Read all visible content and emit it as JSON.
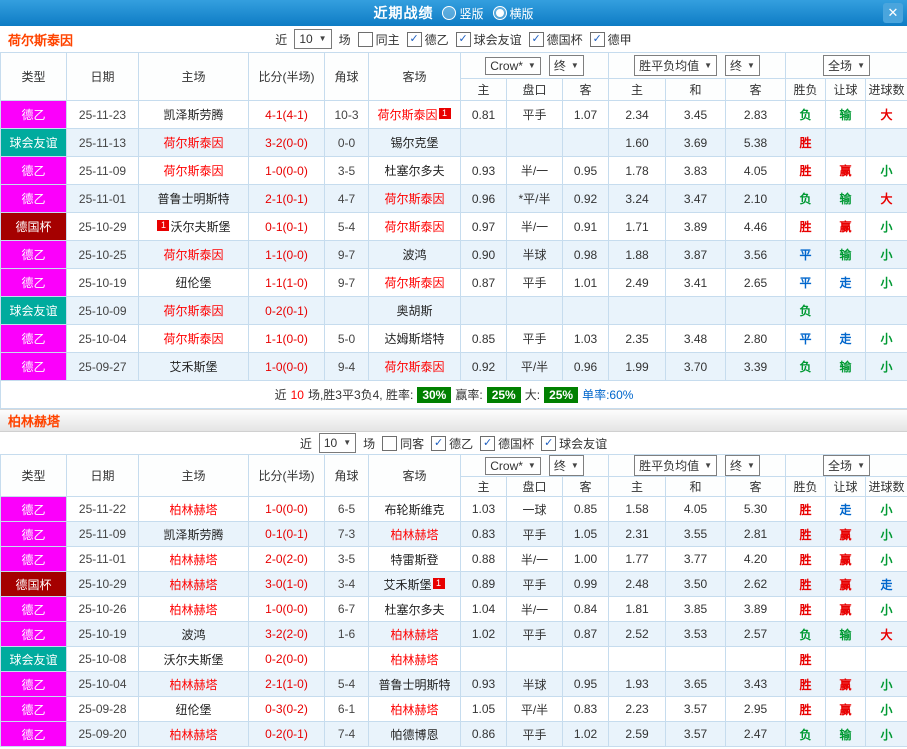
{
  "icons": {
    "dropdown_arrow": "▼",
    "check": "✓"
  },
  "colors": {
    "topbar": "#1583cb",
    "league_de2": "#fb00fb",
    "league_friendly": "#00ab9e",
    "league_cup": "#a50000",
    "win_red": "#e80000",
    "draw_blue": "#0066cc",
    "loss_green": "#009933",
    "rate_badge_green": "#008000",
    "team_highlight": "#ff0000",
    "section_title": "#ff4400",
    "row_alt": "#e9f3fb",
    "grid_border": "#c6dcee"
  },
  "topbar": {
    "title": "近期战绩",
    "radios": [
      {
        "label": "竖版",
        "checked": false
      },
      {
        "label": "横版",
        "checked": true
      }
    ],
    "close": "✕"
  },
  "sections": [
    {
      "team": "荷尔斯泰因",
      "combined_header": true,
      "filter": {
        "near": "近",
        "count": "10",
        "unit": "场",
        "checkboxes": [
          {
            "label": "同主",
            "checked": false
          },
          {
            "label": "德乙",
            "checked": true
          },
          {
            "label": "球会友谊",
            "checked": true
          },
          {
            "label": "德国杯",
            "checked": true
          },
          {
            "label": "德甲",
            "checked": true
          }
        ]
      },
      "header": {
        "cols": [
          "类型",
          "日期",
          "主场",
          "比分(半场)",
          "角球",
          "客场"
        ],
        "dropdowns": [
          "Crow*",
          "终",
          "胜平负均值",
          "终",
          "全场"
        ],
        "sub": [
          "主",
          "盘口",
          "客",
          "主",
          "和",
          "客",
          "胜负",
          "让球",
          "进球数"
        ]
      },
      "rows": [
        {
          "lg": "de2",
          "league": "德乙",
          "date": "25-11-23",
          "home": {
            "name": "凯泽斯劳腾",
            "red": false
          },
          "score": "4-1(4-1)",
          "corners": "10-3",
          "away": {
            "name": "荷尔斯泰因",
            "red": true,
            "badge": "1",
            "pos": "after"
          },
          "crow": [
            "0.81",
            "平手",
            "1.07"
          ],
          "avg": [
            "2.34",
            "3.45",
            "2.83"
          ],
          "res": [
            [
              "负",
              "g"
            ],
            [
              "输",
              "g"
            ],
            [
              "大",
              "r"
            ]
          ]
        },
        {
          "lg": "friendly",
          "league": "球会友谊",
          "date": "25-11-13",
          "home": {
            "name": "荷尔斯泰因",
            "red": true
          },
          "score": "3-2(0-0)",
          "corners": "0-0",
          "away": {
            "name": "锡尔克堡",
            "red": false
          },
          "crow": [
            "",
            "",
            ""
          ],
          "avg": [
            "1.60",
            "3.69",
            "5.38"
          ],
          "res": [
            [
              "胜",
              "r"
            ],
            [
              "",
              ""
            ],
            [
              "",
              ""
            ]
          ]
        },
        {
          "lg": "de2",
          "league": "德乙",
          "date": "25-11-09",
          "home": {
            "name": "荷尔斯泰因",
            "red": true
          },
          "score": "1-0(0-0)",
          "corners": "3-5",
          "away": {
            "name": "杜塞尔多夫",
            "red": false
          },
          "crow": [
            "0.93",
            "半/一",
            "0.95"
          ],
          "avg": [
            "1.78",
            "3.83",
            "4.05"
          ],
          "res": [
            [
              "胜",
              "r"
            ],
            [
              "赢",
              "r"
            ],
            [
              "小",
              "g"
            ]
          ]
        },
        {
          "lg": "de2",
          "league": "德乙",
          "date": "25-11-01",
          "home": {
            "name": "普鲁士明斯特",
            "red": false
          },
          "score": "2-1(0-1)",
          "corners": "4-7",
          "away": {
            "name": "荷尔斯泰因",
            "red": true
          },
          "crow": [
            "0.96",
            "*平/半",
            "0.92"
          ],
          "avg": [
            "3.24",
            "3.47",
            "2.10"
          ],
          "res": [
            [
              "负",
              "g"
            ],
            [
              "输",
              "g"
            ],
            [
              "大",
              "r"
            ]
          ]
        },
        {
          "lg": "cup",
          "league": "德国杯",
          "date": "25-10-29",
          "home": {
            "name": "沃尔夫斯堡",
            "red": false,
            "badge": "1",
            "pos": "before"
          },
          "score": "0-1(0-1)",
          "corners": "5-4",
          "away": {
            "name": "荷尔斯泰因",
            "red": true
          },
          "crow": [
            "0.97",
            "半/一",
            "0.91"
          ],
          "avg": [
            "1.71",
            "3.89",
            "4.46"
          ],
          "res": [
            [
              "胜",
              "r"
            ],
            [
              "赢",
              "r"
            ],
            [
              "小",
              "g"
            ]
          ]
        },
        {
          "lg": "de2",
          "league": "德乙",
          "date": "25-10-25",
          "home": {
            "name": "荷尔斯泰因",
            "red": true
          },
          "score": "1-1(0-0)",
          "corners": "9-7",
          "away": {
            "name": "波鸿",
            "red": false
          },
          "crow": [
            "0.90",
            "半球",
            "0.98"
          ],
          "avg": [
            "1.88",
            "3.87",
            "3.56"
          ],
          "res": [
            [
              "平",
              "b"
            ],
            [
              "输",
              "g"
            ],
            [
              "小",
              "g"
            ]
          ]
        },
        {
          "lg": "de2",
          "league": "德乙",
          "date": "25-10-19",
          "home": {
            "name": "纽伦堡",
            "red": false
          },
          "score": "1-1(1-0)",
          "corners": "9-7",
          "away": {
            "name": "荷尔斯泰因",
            "red": true
          },
          "crow": [
            "0.87",
            "平手",
            "1.01"
          ],
          "avg": [
            "2.49",
            "3.41",
            "2.65"
          ],
          "res": [
            [
              "平",
              "b"
            ],
            [
              "走",
              "b"
            ],
            [
              "小",
              "g"
            ]
          ]
        },
        {
          "lg": "friendly",
          "league": "球会友谊",
          "date": "25-10-09",
          "home": {
            "name": "荷尔斯泰因",
            "red": true
          },
          "score": "0-2(0-1)",
          "corners": "",
          "away": {
            "name": "奥胡斯",
            "red": false
          },
          "crow": [
            "",
            "",
            ""
          ],
          "avg": [
            "",
            "",
            ""
          ],
          "res": [
            [
              "负",
              "g"
            ],
            [
              "",
              ""
            ],
            [
              "",
              ""
            ]
          ]
        },
        {
          "lg": "de2",
          "league": "德乙",
          "date": "25-10-04",
          "home": {
            "name": "荷尔斯泰因",
            "red": true
          },
          "score": "1-1(0-0)",
          "corners": "5-0",
          "away": {
            "name": "达姆斯塔特",
            "red": false
          },
          "crow": [
            "0.85",
            "平手",
            "1.03"
          ],
          "avg": [
            "2.35",
            "3.48",
            "2.80"
          ],
          "res": [
            [
              "平",
              "b"
            ],
            [
              "走",
              "b"
            ],
            [
              "小",
              "g"
            ]
          ]
        },
        {
          "lg": "de2",
          "league": "德乙",
          "date": "25-09-27",
          "home": {
            "name": "艾禾斯堡",
            "red": false
          },
          "score": "1-0(0-0)",
          "corners": "9-4",
          "away": {
            "name": "荷尔斯泰因",
            "red": true
          },
          "crow": [
            "0.92",
            "平/半",
            "0.96"
          ],
          "avg": [
            "1.99",
            "3.70",
            "3.39"
          ],
          "res": [
            [
              "负",
              "g"
            ],
            [
              "输",
              "g"
            ],
            [
              "小",
              "g"
            ]
          ]
        }
      ],
      "summary": {
        "prefix": "近",
        "count": "10",
        "mid": "场,胜3平3负4, 胜率:",
        "win_rate": "30%",
        "label2": "赢率:",
        "rate2": "25%",
        "label3": "大:",
        "rate3": "25%",
        "tail": "单率:60%"
      }
    },
    {
      "team": "柏林赫塔",
      "combined_header": false,
      "filter": {
        "near": "近",
        "count": "10",
        "unit": "场",
        "checkboxes": [
          {
            "label": "同客",
            "checked": false
          },
          {
            "label": "德乙",
            "checked": true
          },
          {
            "label": "德国杯",
            "checked": true
          },
          {
            "label": "球会友谊",
            "checked": true
          }
        ]
      },
      "header": {
        "cols": [
          "类型",
          "日期",
          "主场",
          "比分(半场)",
          "角球",
          "客场"
        ],
        "dropdowns": [
          "Crow*",
          "终",
          "胜平负均值",
          "终",
          "全场"
        ],
        "sub": [
          "主",
          "盘口",
          "客",
          "主",
          "和",
          "客",
          "胜负",
          "让球",
          "进球数"
        ]
      },
      "rows": [
        {
          "lg": "de2",
          "league": "德乙",
          "date": "25-11-22",
          "home": {
            "name": "柏林赫塔",
            "red": true
          },
          "score": "1-0(0-0)",
          "corners": "6-5",
          "away": {
            "name": "布轮斯维克",
            "red": false
          },
          "crow": [
            "1.03",
            "一球",
            "0.85"
          ],
          "avg": [
            "1.58",
            "4.05",
            "5.30"
          ],
          "res": [
            [
              "胜",
              "r"
            ],
            [
              "走",
              "b"
            ],
            [
              "小",
              "g"
            ]
          ]
        },
        {
          "lg": "de2",
          "league": "德乙",
          "date": "25-11-09",
          "home": {
            "name": "凯泽斯劳腾",
            "red": false
          },
          "score": "0-1(0-1)",
          "corners": "7-3",
          "away": {
            "name": "柏林赫塔",
            "red": true
          },
          "crow": [
            "0.83",
            "平手",
            "1.05"
          ],
          "avg": [
            "2.31",
            "3.55",
            "2.81"
          ],
          "res": [
            [
              "胜",
              "r"
            ],
            [
              "赢",
              "r"
            ],
            [
              "小",
              "g"
            ]
          ]
        },
        {
          "lg": "de2",
          "league": "德乙",
          "date": "25-11-01",
          "home": {
            "name": "柏林赫塔",
            "red": true
          },
          "score": "2-0(2-0)",
          "corners": "3-5",
          "away": {
            "name": "特雷斯登",
            "red": false
          },
          "crow": [
            "0.88",
            "半/一",
            "1.00"
          ],
          "avg": [
            "1.77",
            "3.77",
            "4.20"
          ],
          "res": [
            [
              "胜",
              "r"
            ],
            [
              "赢",
              "r"
            ],
            [
              "小",
              "g"
            ]
          ]
        },
        {
          "lg": "cup",
          "league": "德国杯",
          "date": "25-10-29",
          "home": {
            "name": "柏林赫塔",
            "red": true
          },
          "score": "3-0(1-0)",
          "corners": "3-4",
          "away": {
            "name": "艾禾斯堡",
            "red": false,
            "badge": "1",
            "pos": "after"
          },
          "crow": [
            "0.89",
            "平手",
            "0.99"
          ],
          "avg": [
            "2.48",
            "3.50",
            "2.62"
          ],
          "res": [
            [
              "胜",
              "r"
            ],
            [
              "赢",
              "r"
            ],
            [
              "走",
              "b"
            ]
          ]
        },
        {
          "lg": "de2",
          "league": "德乙",
          "date": "25-10-26",
          "home": {
            "name": "柏林赫塔",
            "red": true
          },
          "score": "1-0(0-0)",
          "corners": "6-7",
          "away": {
            "name": "杜塞尔多夫",
            "red": false
          },
          "crow": [
            "1.04",
            "半/一",
            "0.84"
          ],
          "avg": [
            "1.81",
            "3.85",
            "3.89"
          ],
          "res": [
            [
              "胜",
              "r"
            ],
            [
              "赢",
              "r"
            ],
            [
              "小",
              "g"
            ]
          ]
        },
        {
          "lg": "de2",
          "league": "德乙",
          "date": "25-10-19",
          "home": {
            "name": "波鸿",
            "red": false
          },
          "score": "3-2(2-0)",
          "corners": "1-6",
          "away": {
            "name": "柏林赫塔",
            "red": true
          },
          "crow": [
            "1.02",
            "平手",
            "0.87"
          ],
          "avg": [
            "2.52",
            "3.53",
            "2.57"
          ],
          "res": [
            [
              "负",
              "g"
            ],
            [
              "输",
              "g"
            ],
            [
              "大",
              "r"
            ]
          ]
        },
        {
          "lg": "friendly",
          "league": "球会友谊",
          "date": "25-10-08",
          "home": {
            "name": "沃尔夫斯堡",
            "red": false
          },
          "score": "0-2(0-0)",
          "corners": "",
          "away": {
            "name": "柏林赫塔",
            "red": true
          },
          "crow": [
            "",
            "",
            ""
          ],
          "avg": [
            "",
            "",
            ""
          ],
          "res": [
            [
              "胜",
              "r"
            ],
            [
              "",
              ""
            ],
            [
              "",
              ""
            ]
          ]
        },
        {
          "lg": "de2",
          "league": "德乙",
          "date": "25-10-04",
          "home": {
            "name": "柏林赫塔",
            "red": true
          },
          "score": "2-1(1-0)",
          "corners": "5-4",
          "away": {
            "name": "普鲁士明斯特",
            "red": false
          },
          "crow": [
            "0.93",
            "半球",
            "0.95"
          ],
          "avg": [
            "1.93",
            "3.65",
            "3.43"
          ],
          "res": [
            [
              "胜",
              "r"
            ],
            [
              "赢",
              "r"
            ],
            [
              "小",
              "g"
            ]
          ]
        },
        {
          "lg": "de2",
          "league": "德乙",
          "date": "25-09-28",
          "home": {
            "name": "纽伦堡",
            "red": false
          },
          "score": "0-3(0-2)",
          "corners": "6-1",
          "away": {
            "name": "柏林赫塔",
            "red": true
          },
          "crow": [
            "1.05",
            "平/半",
            "0.83"
          ],
          "avg": [
            "2.23",
            "3.57",
            "2.95"
          ],
          "res": [
            [
              "胜",
              "r"
            ],
            [
              "赢",
              "r"
            ],
            [
              "小",
              "g"
            ]
          ]
        },
        {
          "lg": "de2",
          "league": "德乙",
          "date": "25-09-20",
          "home": {
            "name": "柏林赫塔",
            "red": true
          },
          "score": "0-2(0-1)",
          "corners": "7-4",
          "away": {
            "name": "帕德博恩",
            "red": false
          },
          "crow": [
            "0.86",
            "平手",
            "1.02"
          ],
          "avg": [
            "2.59",
            "3.57",
            "2.47"
          ],
          "res": [
            [
              "负",
              "g"
            ],
            [
              "输",
              "g"
            ],
            [
              "小",
              "g"
            ]
          ]
        }
      ],
      "summary": null
    }
  ]
}
